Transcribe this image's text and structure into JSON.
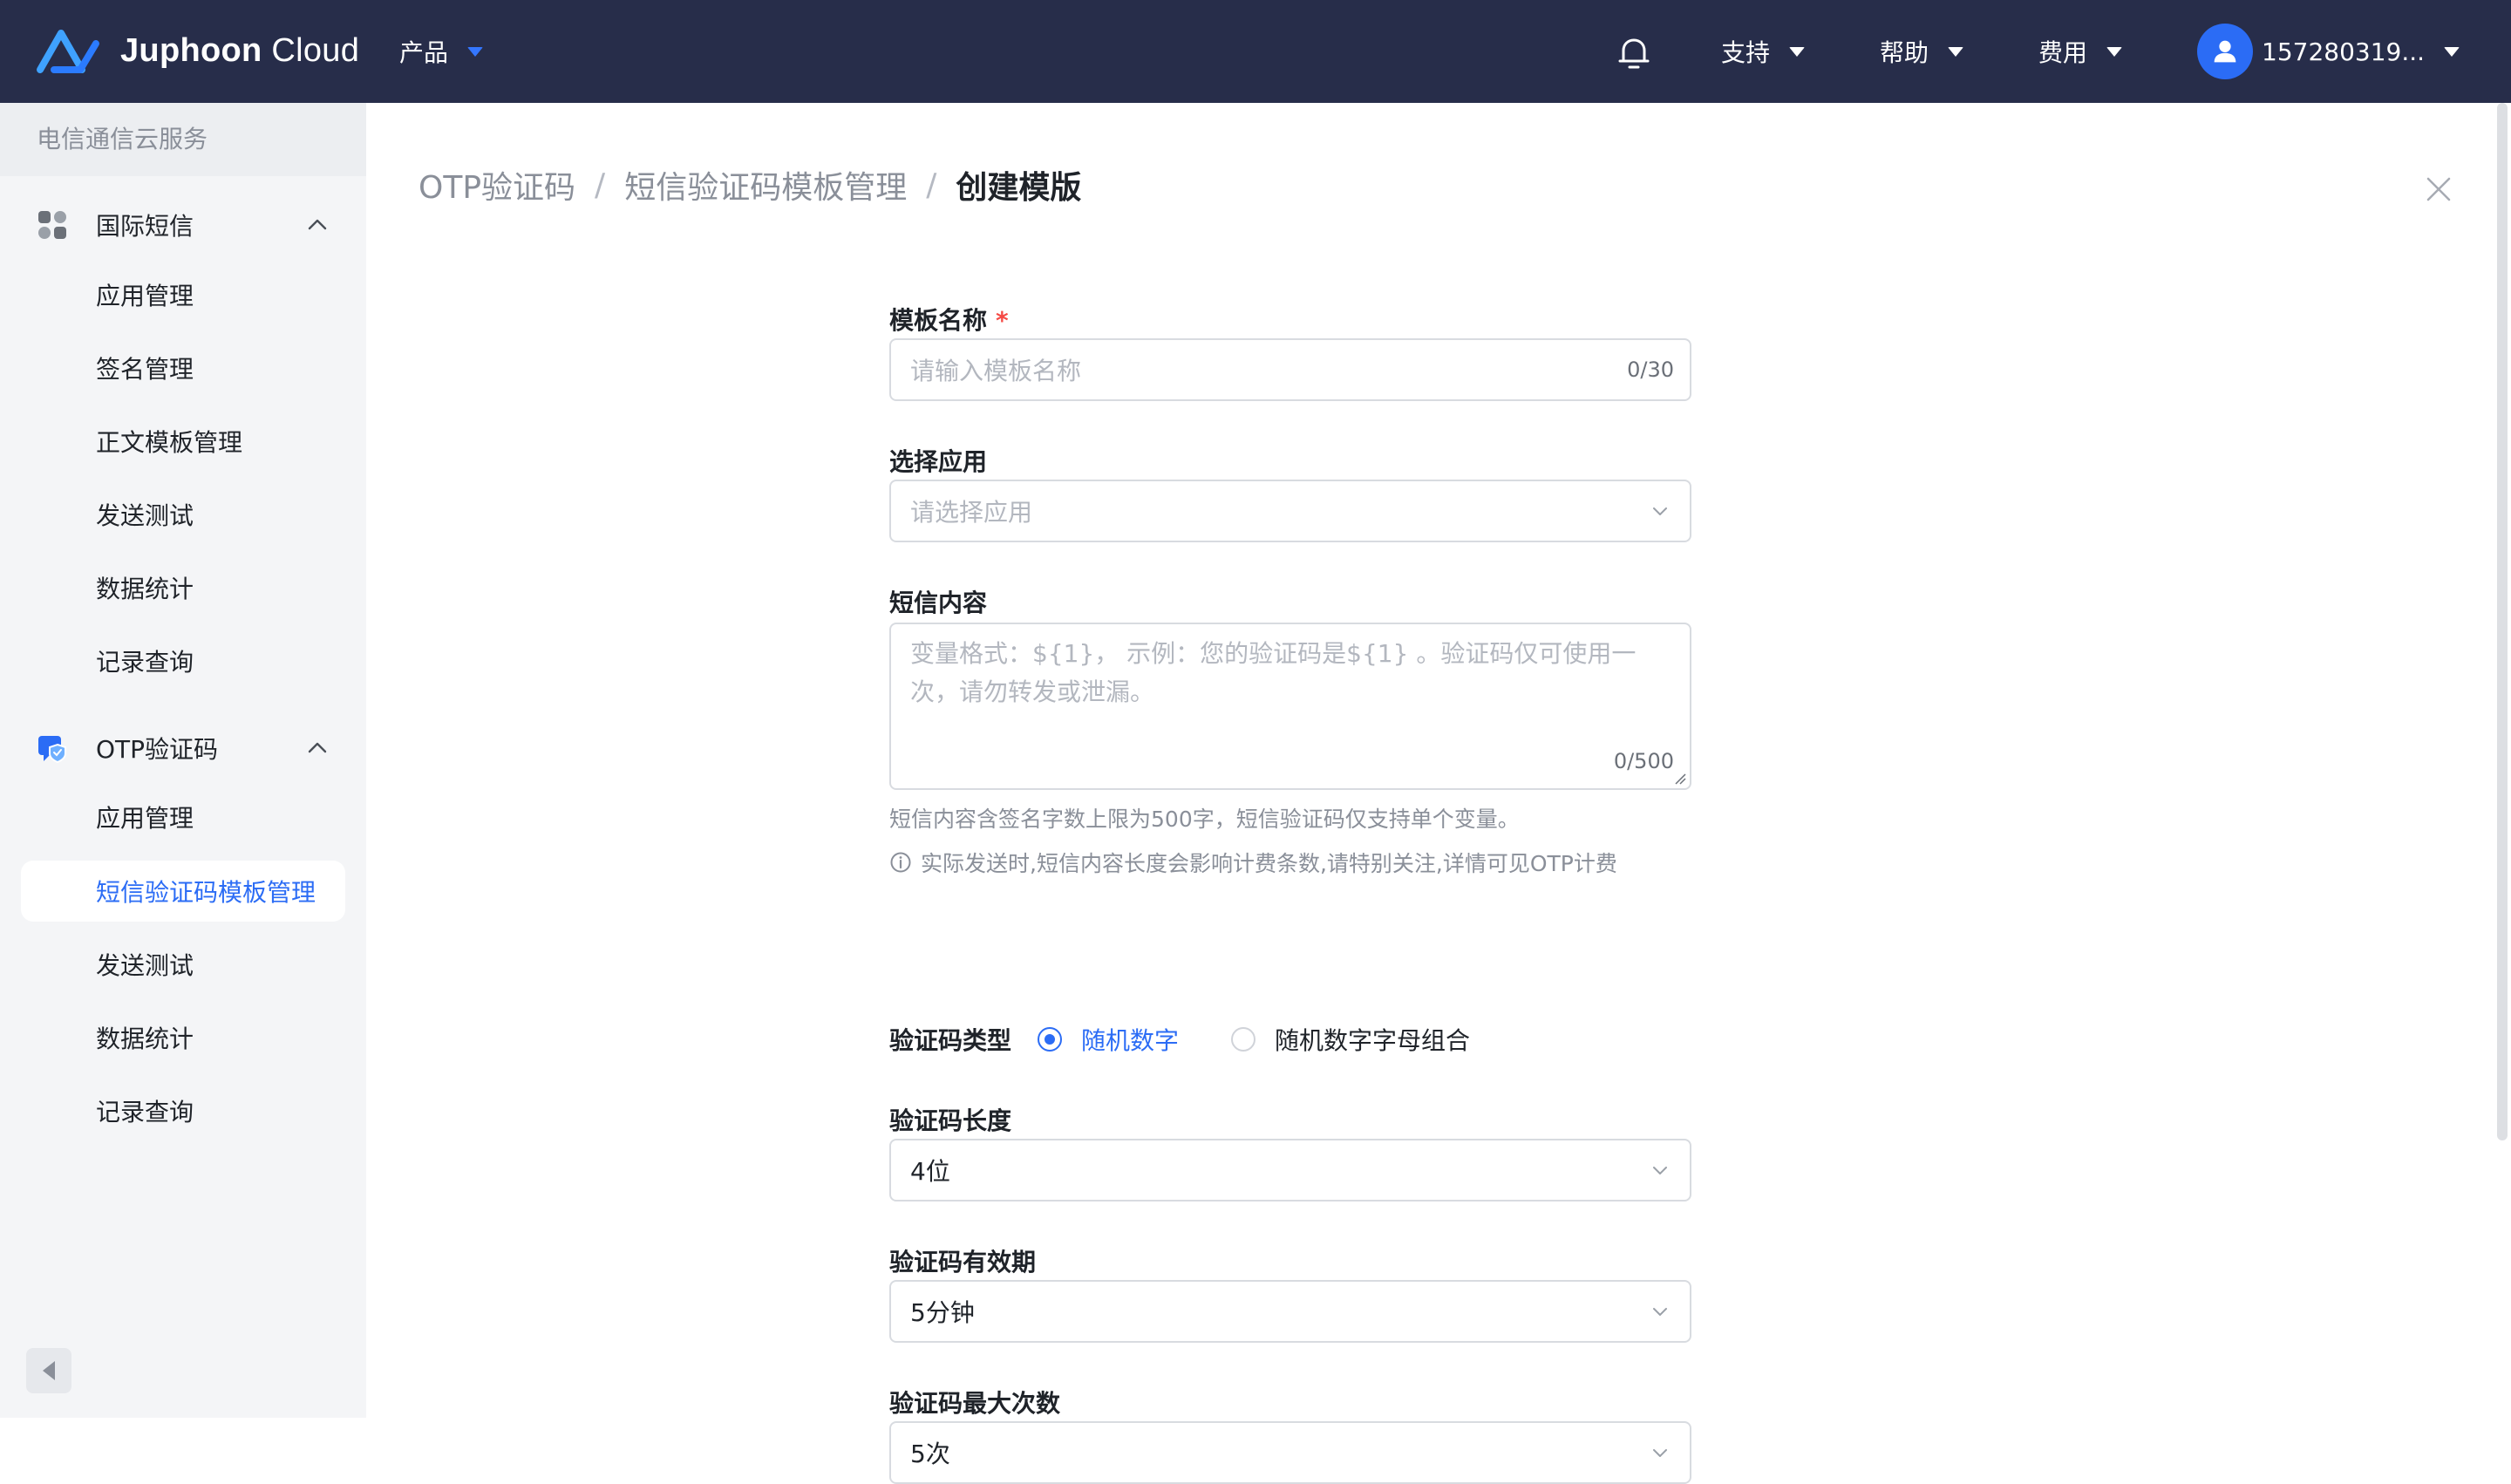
{
  "brand": {
    "name_bold": "Juphoon",
    "name_light": "Cloud"
  },
  "topnav": {
    "products": "产品",
    "support": "支持",
    "help": "帮助",
    "billing": "费用",
    "user_id": "157280319..."
  },
  "sidebar": {
    "header": "电信通信云服务",
    "groups": [
      {
        "label": "国际短信",
        "items": [
          "应用管理",
          "签名管理",
          "正文模板管理",
          "发送测试",
          "数据统计",
          "记录查询"
        ]
      },
      {
        "label": "OTP验证码",
        "items": [
          "应用管理",
          "短信验证码模板管理",
          "发送测试",
          "数据统计",
          "记录查询"
        ],
        "active_index": 1
      }
    ]
  },
  "breadcrumb": {
    "level1": "OTP验证码",
    "level2": "短信验证码模板管理",
    "current": "创建模版",
    "separator": "/"
  },
  "form": {
    "template_name": {
      "label": "模板名称",
      "required_mark": "*",
      "placeholder": "请输入模板名称",
      "counter": "0/30"
    },
    "app_select": {
      "label": "选择应用",
      "placeholder": "请选择应用"
    },
    "sms_content": {
      "label": "短信内容",
      "placeholder": "变量格式：${1}， 示例：您的验证码是${1} 。验证码仅可使用一次，请勿转发或泄漏。",
      "counter": "0/500",
      "hint": "短信内容含签名字数上限为500字，短信验证码仅支持单个变量。",
      "notice": "实际发送时,短信内容长度会影响计费条数,请特别关注,详情可见OTP计费"
    },
    "code_type": {
      "label": "验证码类型",
      "options": [
        "随机数字",
        "随机数字字母组合"
      ],
      "selected_index": 0
    },
    "code_length": {
      "label": "验证码长度",
      "value": "4位"
    },
    "code_validity": {
      "label": "验证码有效期",
      "value": "5分钟"
    },
    "code_max_attempts": {
      "label": "验证码最大次数",
      "value": "5次"
    }
  },
  "colors": {
    "topbar": "#272d4a",
    "accent": "#2b6cf5",
    "sidebar_bg": "#f4f5f7",
    "required": "#f54a45"
  }
}
